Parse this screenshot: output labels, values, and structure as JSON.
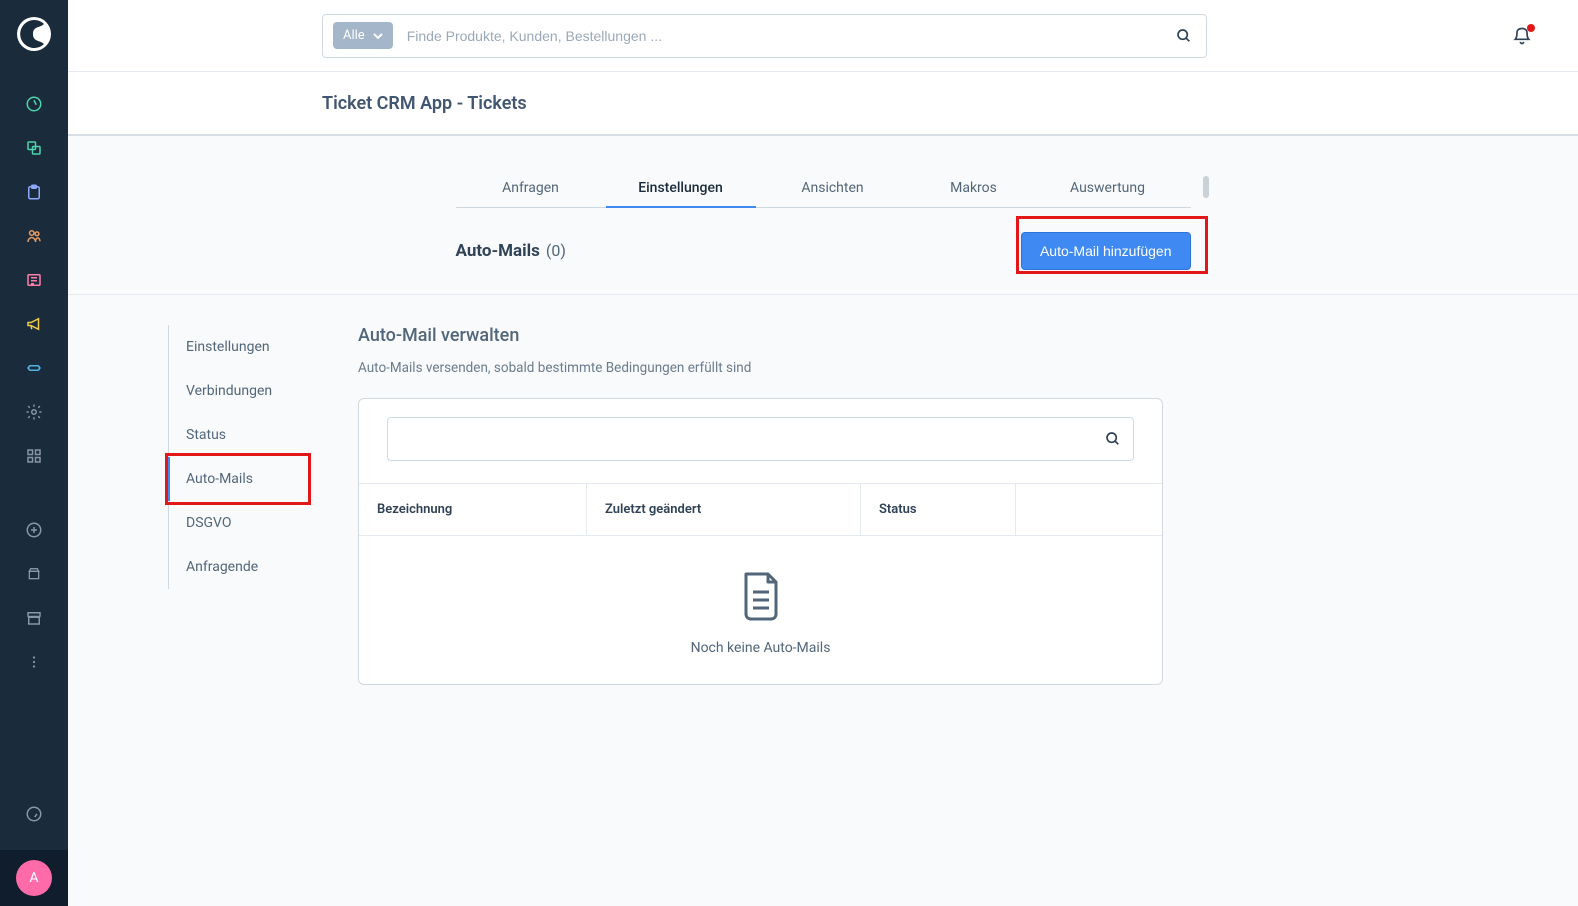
{
  "search": {
    "scope_label": "Alle",
    "placeholder": "Finde Produkte, Kunden, Bestellungen ..."
  },
  "page_title": "Ticket CRM App - Tickets",
  "tabs": [
    {
      "label": "Anfragen"
    },
    {
      "label": "Einstellungen"
    },
    {
      "label": "Ansichten"
    },
    {
      "label": "Makros"
    },
    {
      "label": "Auswertung"
    }
  ],
  "section": {
    "title": "Auto-Mails",
    "count": "(0)",
    "add_button": "Auto-Mail hinzufügen"
  },
  "settings_nav": [
    {
      "label": "Einstellungen"
    },
    {
      "label": "Verbindungen"
    },
    {
      "label": "Status"
    },
    {
      "label": "Auto-Mails"
    },
    {
      "label": "DSGVO"
    },
    {
      "label": "Anfragende"
    }
  ],
  "panel": {
    "title": "Auto-Mail verwalten",
    "subtitle": "Auto-Mails versenden, sobald bestimmte Bedingungen erfüllt sind",
    "table": {
      "columns": [
        "Bezeichnung",
        "Zuletzt geändert",
        "Status"
      ],
      "empty_message": "Noch keine Auto-Mails"
    }
  },
  "avatar": {
    "initial": "A"
  },
  "colors": {
    "primary": "#3f8af2",
    "rail_bg": "#1a2b3c",
    "highlight": "#e21818"
  },
  "rail_icons": [
    {
      "name": "dashboard",
      "color": "#4dd4ac"
    },
    {
      "name": "catalog",
      "color": "#4dd4ac"
    },
    {
      "name": "orders",
      "color": "#8fa9ff"
    },
    {
      "name": "customers",
      "color": "#e89a5d"
    },
    {
      "name": "content",
      "color": "#ff7ea9"
    },
    {
      "name": "marketing",
      "color": "#f2c94c"
    },
    {
      "name": "extensions",
      "color": "#4fb5e6"
    },
    {
      "name": "settings",
      "color": "#8896a6"
    },
    {
      "name": "apps",
      "color": "#8896a6"
    }
  ],
  "rail_icons_lower": [
    {
      "name": "add",
      "color": "#8896a6"
    },
    {
      "name": "shop",
      "color": "#8896a6"
    },
    {
      "name": "store",
      "color": "#8896a6"
    },
    {
      "name": "more",
      "color": "#8896a6"
    }
  ]
}
